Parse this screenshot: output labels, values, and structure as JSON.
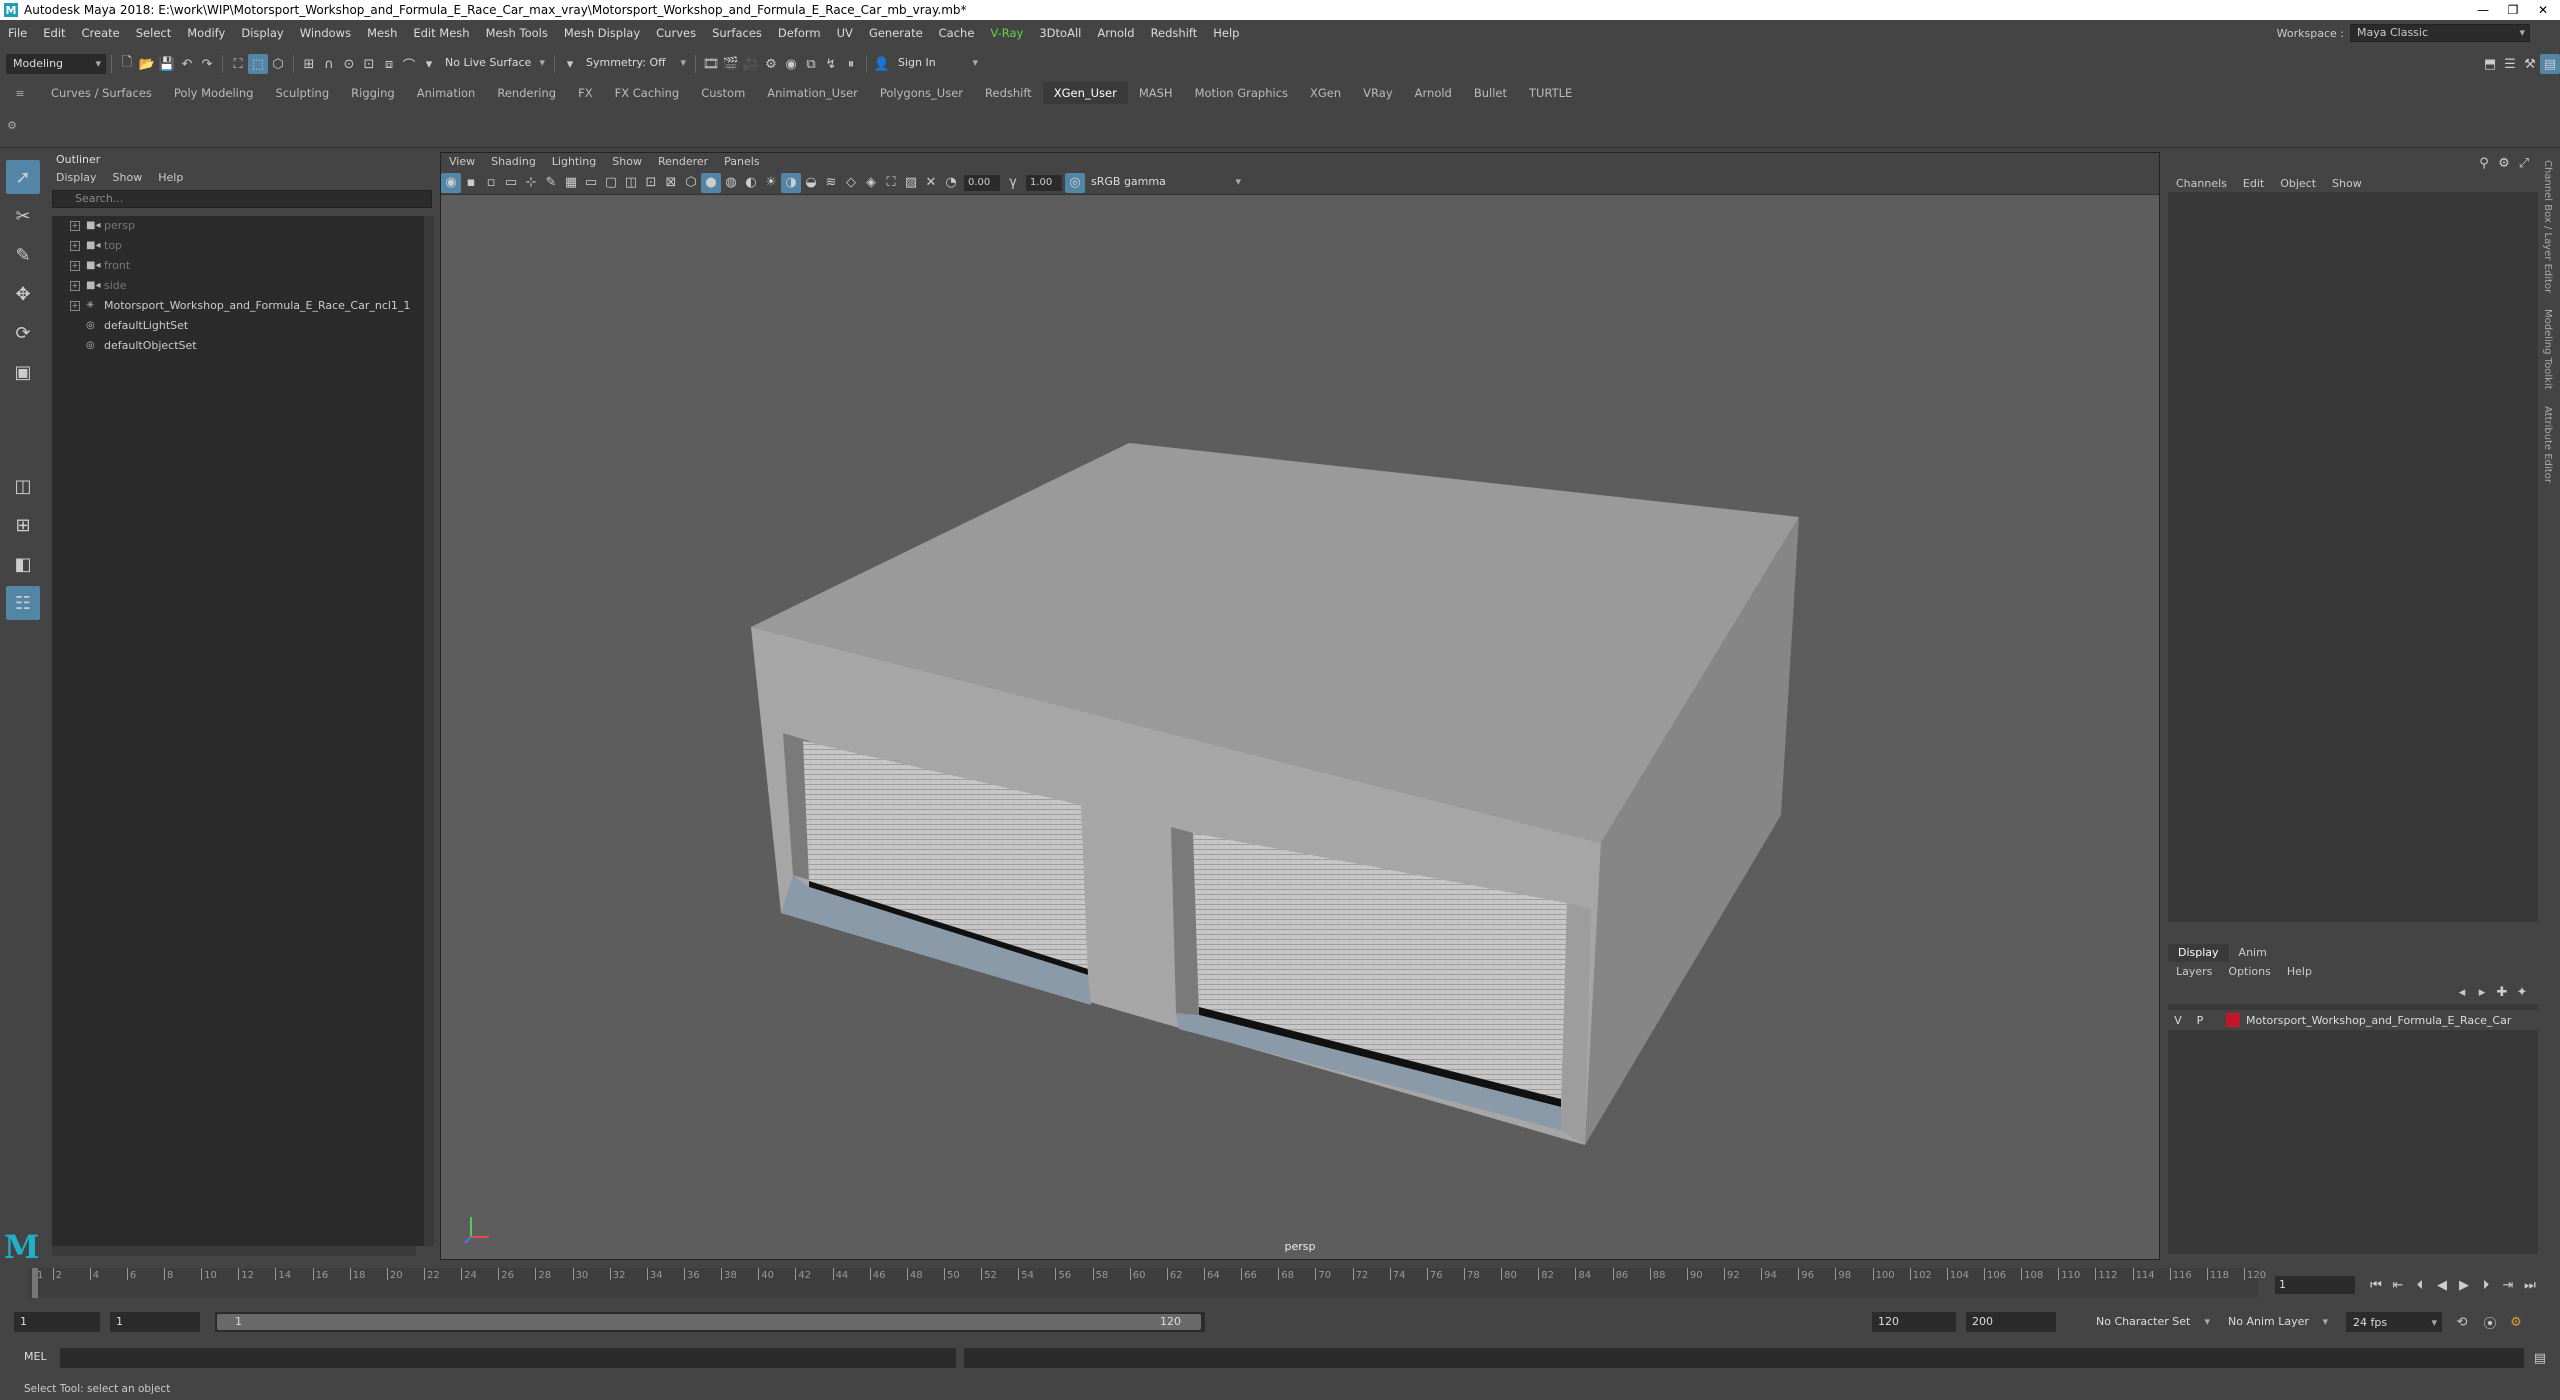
{
  "window": {
    "title": "Autodesk Maya 2018: E:\\work\\WIP\\Motorsport_Workshop_and_Formula_E_Race_Car_max_vray\\Motorsport_Workshop_and_Formula_E_Race_Car_mb_vray.mb*",
    "minimize": "—",
    "restore": "❐",
    "close": "✕"
  },
  "menubar": {
    "items": [
      "File",
      "Edit",
      "Create",
      "Select",
      "Modify",
      "Display",
      "Windows",
      "Mesh",
      "Edit Mesh",
      "Mesh Tools",
      "Mesh Display",
      "Curves",
      "Surfaces",
      "Deform",
      "UV",
      "Generate",
      "Cache",
      "V-Ray",
      "3DtoAll",
      "Arnold",
      "Redshift",
      "Help"
    ]
  },
  "workspace": {
    "label": "Workspace :",
    "value": "Maya Classic"
  },
  "statusline": {
    "mode": "Modeling",
    "live_surface": "No Live Surface",
    "symmetry": "Symmetry: Off",
    "signin": "Sign In"
  },
  "shelf": {
    "tabs": [
      "Curves / Surfaces",
      "Poly Modeling",
      "Sculpting",
      "Rigging",
      "Animation",
      "Rendering",
      "FX",
      "FX Caching",
      "Custom",
      "Animation_User",
      "Polygons_User",
      "Redshift",
      "XGen_User",
      "MASH",
      "Motion Graphics",
      "XGen",
      "VRay",
      "Arnold",
      "Bullet",
      "TURTLE"
    ],
    "active": "XGen_User"
  },
  "outliner": {
    "title": "Outliner",
    "menu": [
      "Display",
      "Show",
      "Help"
    ],
    "search_placeholder": "Search...",
    "items": [
      {
        "label": "persp",
        "icon": "camera-icon",
        "dim": true
      },
      {
        "label": "top",
        "icon": "camera-icon",
        "dim": true
      },
      {
        "label": "front",
        "icon": "camera-icon",
        "dim": true
      },
      {
        "label": "side",
        "icon": "camera-icon",
        "dim": true
      },
      {
        "label": "Motorsport_Workshop_and_Formula_E_Race_Car_ncl1_1",
        "icon": "group-icon",
        "dim": false
      },
      {
        "label": "defaultLightSet",
        "icon": "set-icon",
        "dim": false
      },
      {
        "label": "defaultObjectSet",
        "icon": "set-icon",
        "dim": false
      }
    ]
  },
  "viewport": {
    "menu": [
      "View",
      "Shading",
      "Lighting",
      "Show",
      "Renderer",
      "Panels"
    ],
    "exposure": "0.00",
    "gamma": "1.00",
    "color_space": "sRGB gamma",
    "camera_label": "persp"
  },
  "channelbox": {
    "menu": [
      "Channels",
      "Edit",
      "Object",
      "Show"
    ]
  },
  "layereditor": {
    "tabs": [
      "Display",
      "Anim"
    ],
    "menu": [
      "Layers",
      "Options",
      "Help"
    ],
    "layer": {
      "v": "V",
      "p": "P",
      "name": "Motorsport_Workshop_and_Formula_E_Race_Car",
      "color": "#c0152a"
    }
  },
  "sidetabs": [
    "Channel Box / Layer Editor",
    "Modeling Toolkit",
    "Attribute Editor"
  ],
  "timeslider": {
    "ticks": [
      "1",
      "2",
      "4",
      "6",
      "8",
      "10",
      "12",
      "14",
      "16",
      "18",
      "20",
      "22",
      "24",
      "26",
      "28",
      "30",
      "32",
      "34",
      "36",
      "38",
      "40",
      "42",
      "44",
      "46",
      "48",
      "50",
      "52",
      "54",
      "56",
      "58",
      "60",
      "62",
      "64",
      "66",
      "68",
      "70",
      "72",
      "74",
      "76",
      "78",
      "80",
      "82",
      "84",
      "86",
      "88",
      "90",
      "92",
      "94",
      "96",
      "98",
      "100",
      "102",
      "104",
      "106",
      "108",
      "110",
      "112",
      "114",
      "116",
      "118",
      "120"
    ],
    "current_frame": "1"
  },
  "rangeslider": {
    "start": "1",
    "playback_start": "1",
    "bar_start": "1",
    "bar_end": "120",
    "playback_end": "120",
    "end": "200",
    "character_set": "No Character Set",
    "anim_layer": "No Anim Layer",
    "fps": "24 fps"
  },
  "cmdline": {
    "label": "MEL"
  },
  "helpline": {
    "text": "Select Tool: select an object"
  }
}
